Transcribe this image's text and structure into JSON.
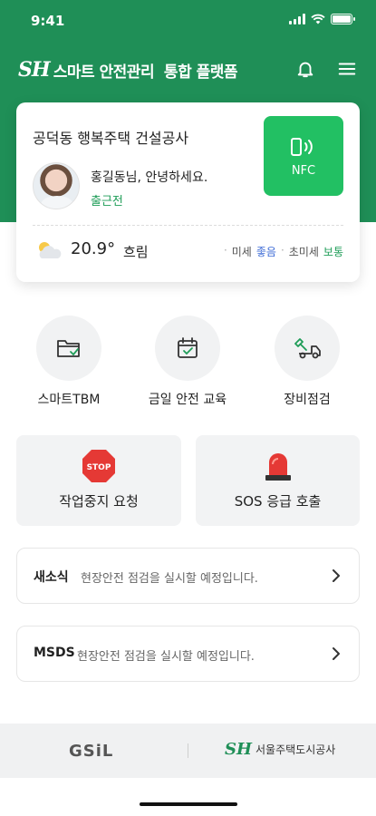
{
  "status_bar": {
    "time": "9:41"
  },
  "app_bar": {
    "logo_mark": "SH",
    "title": "스마트 안전관리  통합 플랫폼"
  },
  "site_card": {
    "site_name": "공덕동 행복주택 건설공사",
    "greeting": "홍길동님, 안녕하세요.",
    "commute_status": "출근전",
    "nfc_label": "NFC"
  },
  "weather": {
    "temperature": "20.9°",
    "sky": "흐림",
    "fine_dust_label": "미세",
    "fine_dust_value": "좋음",
    "ultrafine_dust_label": "초미세",
    "ultrafine_dust_value": "보통"
  },
  "quick_menu": [
    {
      "label": "스마트TBM",
      "icon": "folder-check-icon"
    },
    {
      "label": "금일 안전 교육",
      "icon": "calendar-check-icon"
    },
    {
      "label": "장비점검",
      "icon": "truck-wrench-icon"
    }
  ],
  "action_tiles": [
    {
      "label": "작업중지 요청",
      "icon": "stop-sign-icon",
      "icon_text": "STOP"
    },
    {
      "label": "SOS 응급 호출",
      "icon": "siren-icon"
    }
  ],
  "notices": [
    {
      "tag": "새소식",
      "text": "현장안전 점검을 실시할 예정입니다."
    },
    {
      "tag": "MSDS",
      "text": "현장안전 점검을 실시할 예정입니다."
    }
  ],
  "footer": {
    "partner_left": "GSiL",
    "partner_right_mark": "SH",
    "partner_right_name": "서울주택도시공사"
  },
  "colors": {
    "brand_green": "#1f8f57",
    "nfc_green": "#22c063",
    "stop_red": "#e53935",
    "good_blue": "#3d6bd6"
  }
}
